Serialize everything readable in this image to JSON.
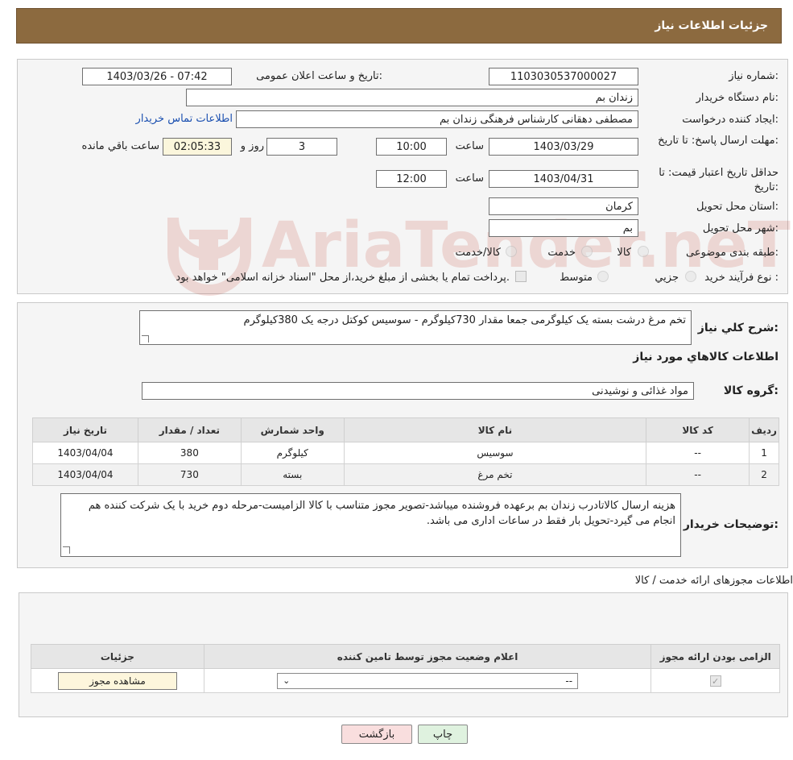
{
  "header": {
    "title": "جزئیات اطلاعات نیاز"
  },
  "form": {
    "need_number_label": "شماره نیاز:",
    "need_number": "1103030537000027",
    "announce_label": "تاریخ و ساعت اعلان عمومی:",
    "announce_value": "1403/03/26 - 07:42",
    "buyer_label": "نام دستگاه خریدار:",
    "buyer_value": "زندان بم",
    "creator_label": "ایجاد کننده درخواست:",
    "creator_value": "مصطفی دهقانی کارشناس فرهنگی زندان بم",
    "contact_link": "اطلاعات تماس خریدار",
    "reply_deadline_label": "مهلت ارسال پاسخ: تا تاریخ:",
    "reply_date": "1403/03/29",
    "time_label": "ساعت",
    "reply_time": "10:00",
    "days_value": "3",
    "days_label": "روز و",
    "remaining_value": "02:05:33",
    "remaining_label": "ساعت باقي مانده",
    "price_validity_label": "حداقل تاریخ اعتبار قیمت: تا تاریخ:",
    "price_date": "1403/04/31",
    "price_time": "12:00",
    "province_label": "استان محل تحویل:",
    "province_value": "کرمان",
    "city_label": "شهر محل تحویل:",
    "city_value": "بم",
    "category_label": "طبقه بندی موضوعی:",
    "category_options": [
      "کالا",
      "خدمت",
      "کالا/خدمت"
    ],
    "process_label": "نوع فرآیند خرید :",
    "process_options": [
      "جزیي",
      "متوسط"
    ],
    "process_note": "پرداخت تمام یا بخشی از مبلغ خرید،از محل \"اسناد خزانه اسلامی\" خواهد بود."
  },
  "description": {
    "label": "شرح کلي نياز:",
    "value": "تخم مرغ درشت بسته یک کیلوگرمی جمعا مقدار 730کیلوگرم - سوسیس کوکتل درجه یک 380کیلوگرم"
  },
  "goods": {
    "title": "اطلاعات کالاهاي مورد نياز",
    "group_label": "گروه کالا:",
    "group_value": "مواد غذائی و نوشیدنی",
    "columns": [
      "رديف",
      "کد کالا",
      "نام کالا",
      "واحد شمارش",
      "تعداد / مقدار",
      "تاريخ نياز"
    ],
    "rows": [
      {
        "row": "1",
        "code": "--",
        "name": "سوسیس",
        "unit": "کیلوگرم",
        "qty": "380",
        "date": "1403/04/04"
      },
      {
        "row": "2",
        "code": "--",
        "name": "تخم مرغ",
        "unit": "بسته",
        "qty": "730",
        "date": "1403/04/04"
      }
    ]
  },
  "buyer_notes": {
    "label": "توضیحات خریدار:",
    "value": "هزینه ارسال کالاتادرب زندان بم برعهده فروشنده میباشد-تصویر مجوز متناسب با کالا الزامیست-مرحله دوم خرید با یک شرکت کننده هم انجام می گیرد-تحویل بار فقط در ساعات اداری می باشد."
  },
  "permits": {
    "title": "اطلاعات مجوزهای ارائه خدمت / کالا",
    "columns": [
      "الزامی بودن ارائه مجوز",
      "اعلام وضعیت مجوز توسط تامین کننده",
      "جزئیات"
    ],
    "select_value": "--",
    "view_button": "مشاهده مجوز"
  },
  "actions": {
    "print": "چاپ",
    "back": "بازگشت"
  },
  "watermark": "AriaTender.neT",
  "colors": {
    "header": "#8c6a3f",
    "link": "#1a4fb0",
    "back_button": "#f9dede",
    "print_button": "#dff2df",
    "watermark": "#c0392b"
  }
}
